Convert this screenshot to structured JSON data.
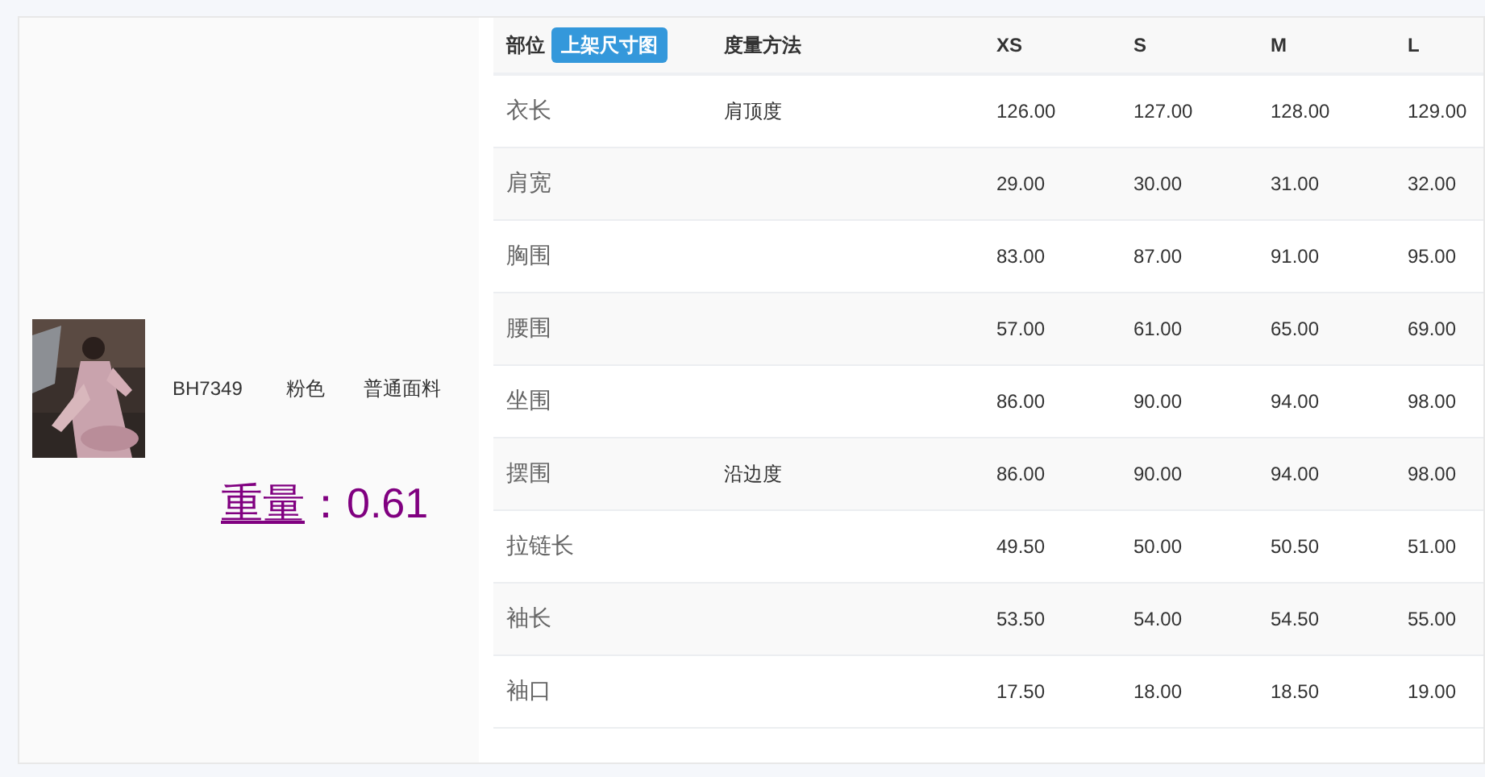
{
  "product": {
    "code": "BH7349",
    "color_name": "粉色",
    "fabric": "普通面料",
    "weight": {
      "label": "重量",
      "value": "：0.61"
    }
  },
  "table": {
    "columns": [
      {
        "label": "部位",
        "badge": "上架尺寸图"
      },
      {
        "label": "度量方法"
      },
      {
        "label": "XS"
      },
      {
        "label": "S"
      },
      {
        "label": "M"
      },
      {
        "label": "L"
      }
    ],
    "rows": [
      {
        "part": "衣长",
        "method": "肩顶度",
        "values": [
          "126.00",
          "127.00",
          "128.00",
          "129.00"
        ]
      },
      {
        "part": "肩宽",
        "values": [
          "29.00",
          "30.00",
          "31.00",
          "32.00"
        ]
      },
      {
        "part": "胸围",
        "values": [
          "83.00",
          "87.00",
          "91.00",
          "95.00"
        ]
      },
      {
        "part": "腰围",
        "values": [
          "57.00",
          "61.00",
          "65.00",
          "69.00"
        ]
      },
      {
        "part": "坐围",
        "values": [
          "86.00",
          "90.00",
          "94.00",
          "98.00"
        ]
      },
      {
        "part": "摆围",
        "method": "沿边度",
        "values": [
          "86.00",
          "90.00",
          "94.00",
          "98.00"
        ]
      },
      {
        "part": "拉链长",
        "values": [
          "49.50",
          "50.00",
          "50.50",
          "51.00"
        ]
      },
      {
        "part": "袖长",
        "values": [
          "53.50",
          "54.00",
          "54.50",
          "55.00"
        ]
      },
      {
        "part": "袖口",
        "values": [
          "17.50",
          "18.00",
          "18.50",
          "19.00"
        ]
      }
    ]
  }
}
